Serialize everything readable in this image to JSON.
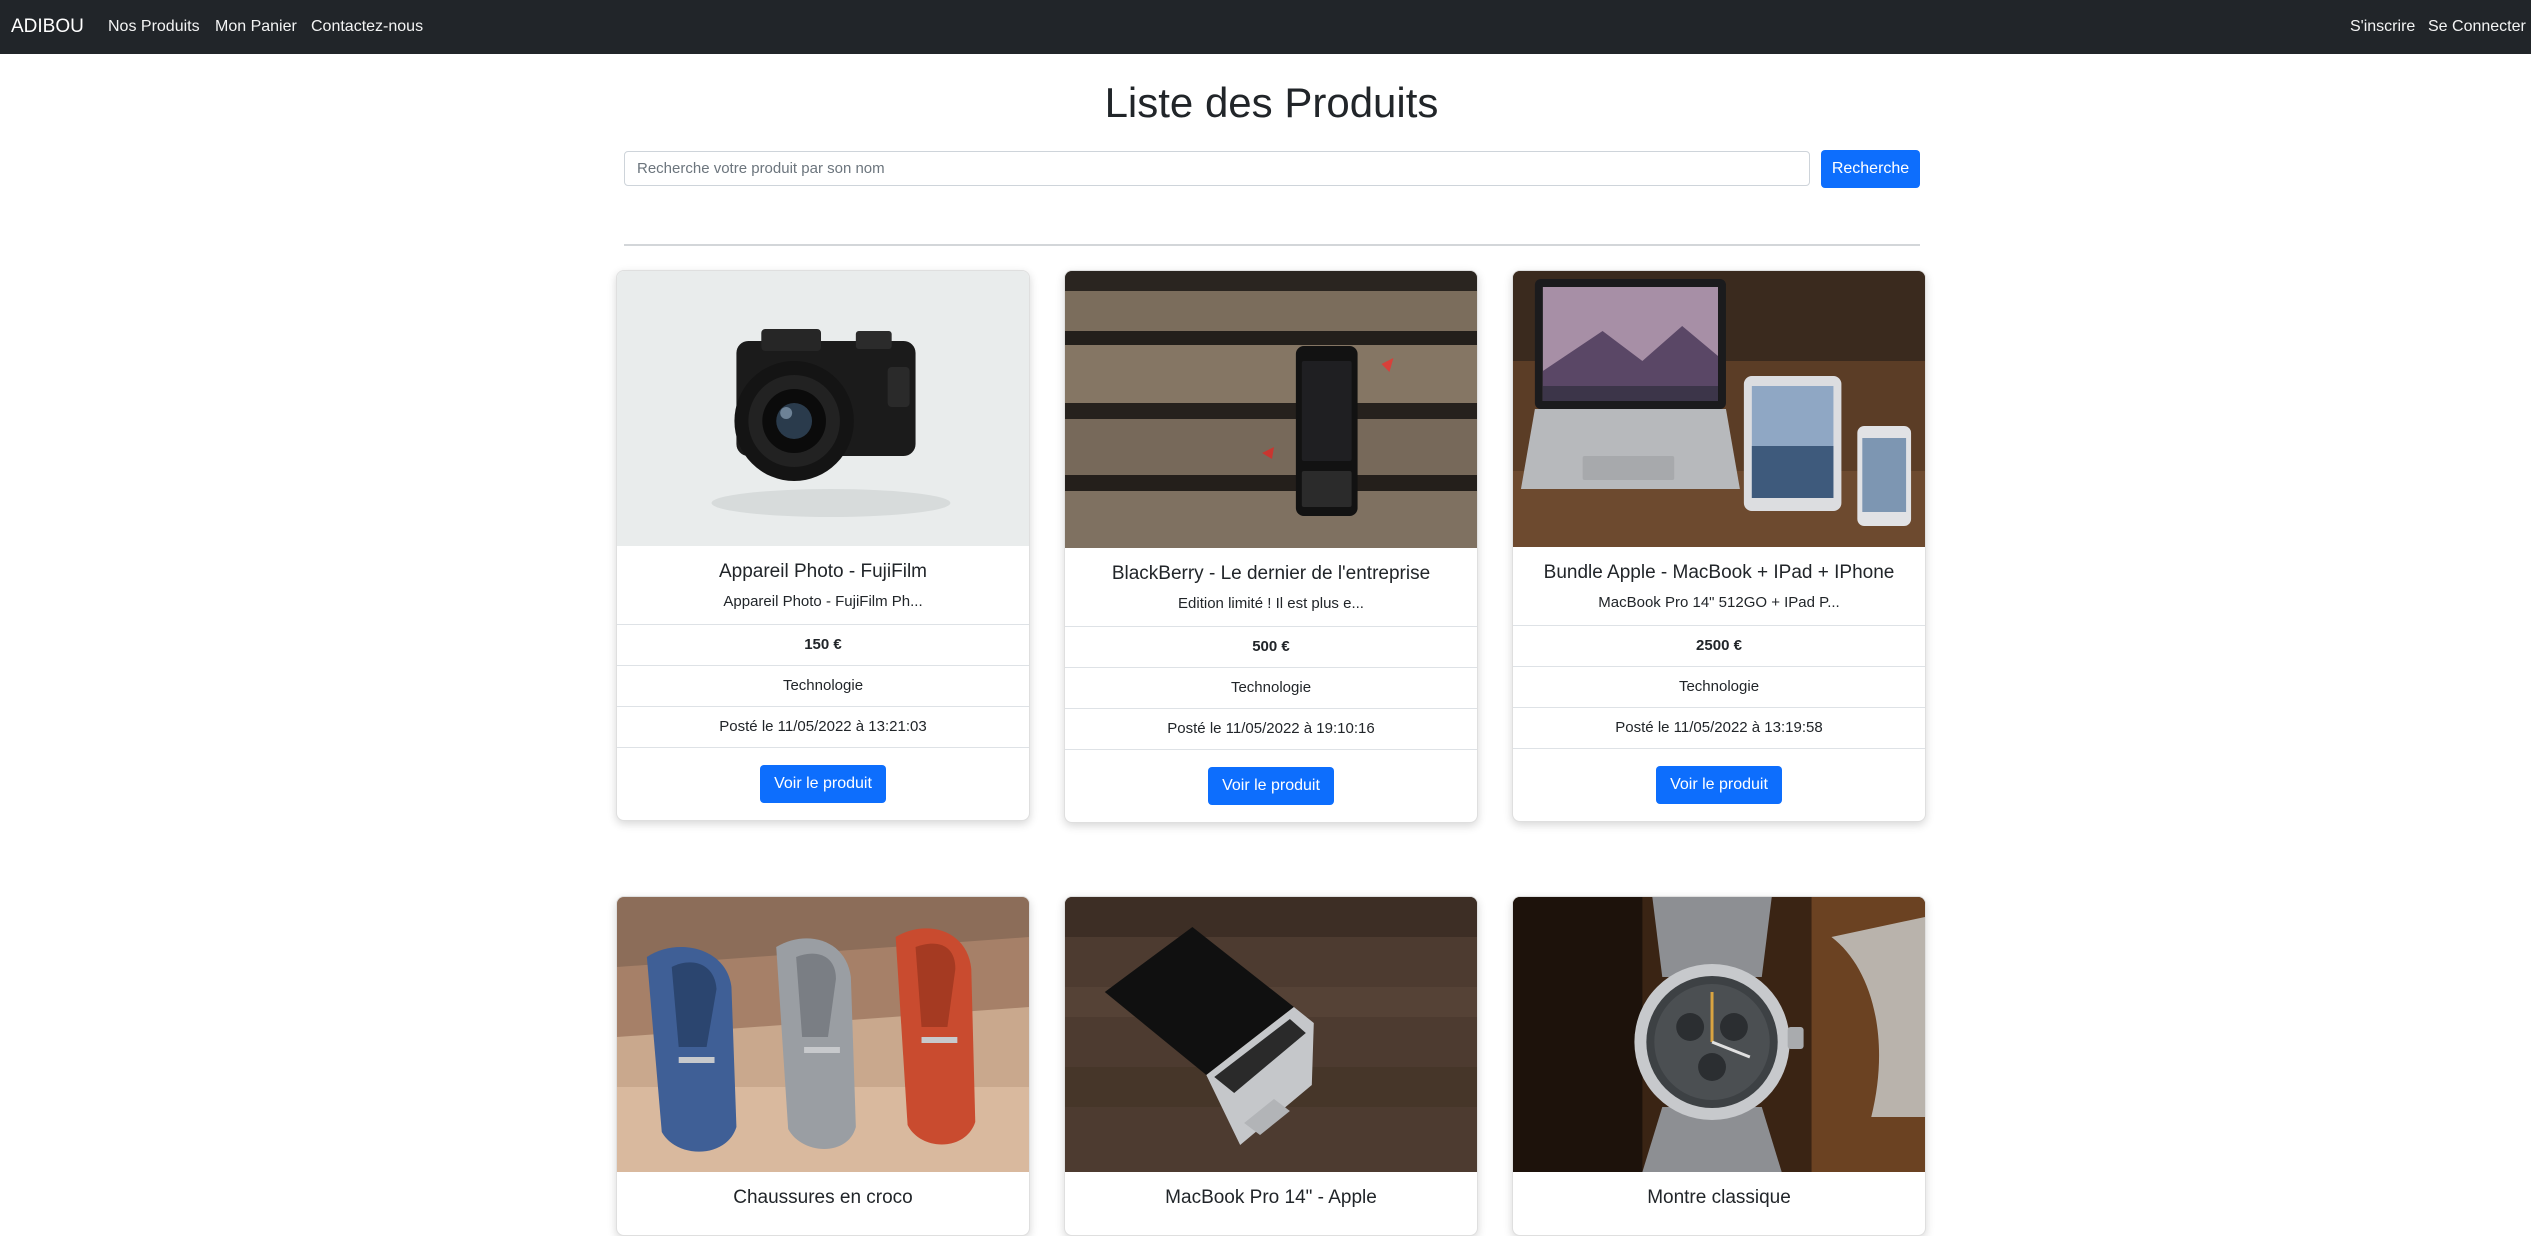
{
  "navbar": {
    "brand": "ADIBOU",
    "links": [
      "Nos Produits",
      "Mon Panier",
      "Contactez-nous"
    ],
    "right_links": [
      "S'inscrire",
      "Se Connecter"
    ]
  },
  "page": {
    "title": "Liste des Produits"
  },
  "search": {
    "placeholder": "Recherche votre produit par son nom",
    "button_label": "Recherche"
  },
  "products": [
    {
      "title": "Appareil Photo - FujiFilm",
      "description": "Appareil Photo - FujiFilm Ph...",
      "price": "150 €",
      "category": "Technologie",
      "posted": "Posté le 11/05/2022 à 13:21:03",
      "button": "Voir le produit",
      "image_icon": "camera-photo"
    },
    {
      "title": "BlackBerry - Le dernier de l'entreprise",
      "description": "Edition limité ! Il est plus e...",
      "price": "500 €",
      "category": "Technologie",
      "posted": "Posté le 11/05/2022 à 19:10:16",
      "button": "Voir le produit",
      "image_icon": "smartphone-photo"
    },
    {
      "title": "Bundle Apple - MacBook + IPad + IPhone",
      "description": "MacBook Pro 14\" 512GO + IPad P...",
      "price": "2500 €",
      "category": "Technologie",
      "posted": "Posté le 11/05/2022 à 13:19:58",
      "button": "Voir le produit",
      "image_icon": "devices-photo"
    },
    {
      "title": "Chaussures en croco",
      "image_icon": "shoes-photo"
    },
    {
      "title": "MacBook Pro 14\" - Apple",
      "image_icon": "laptop-photo"
    },
    {
      "title": "Montre classique",
      "image_icon": "watch-photo"
    }
  ],
  "colors": {
    "navbar_bg": "#212529",
    "primary": "#0d6efd",
    "text": "#212529"
  }
}
